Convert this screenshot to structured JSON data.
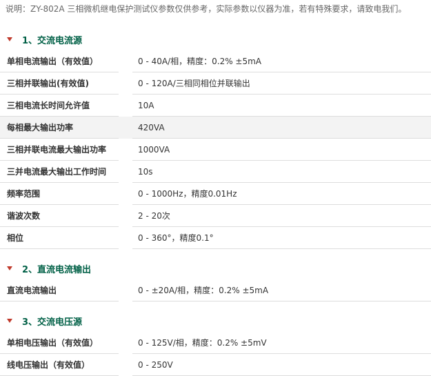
{
  "note": "说明：ZY-802A 三相微机继电保护测试仪参数仅供参考，实际参数以仪器为准，若有特殊要求，请致电我们。",
  "colors": {
    "section_title": "#006046",
    "caret": "#c0392b",
    "row_shade": "#f3f3f3",
    "divider": "#dddddd"
  },
  "sections": [
    {
      "title": "1、交流电流源",
      "rows": [
        {
          "label": "单相电流输出（有效值）",
          "value": "0 - 40A/相，精度：0.2%  ±5mA"
        },
        {
          "label": "三相并联输出(有效值)",
          "value": "0 - 120A/三相同相位并联输出"
        },
        {
          "label": "三相电流长时间允许值",
          "value": "10A"
        },
        {
          "label": "每相最大输出功率",
          "value": "420VA"
        },
        {
          "label": "三相并联电流最大输出功率",
          "value": "1000VA"
        },
        {
          "label": "三并电流最大输出工作时间",
          "value": "10s"
        },
        {
          "label": "频率范围",
          "value": "0 - 1000Hz，精度0.01Hz"
        },
        {
          "label": "谐波次数",
          "value": "2 - 20次"
        },
        {
          "label": "相位",
          "value": "0 - 360°，精度0.1°"
        }
      ]
    },
    {
      "title": "2、直流电流输出",
      "rows": [
        {
          "label": "直流电流输出",
          "value": "0 - ±20A/相，精度：0.2%  ±5mA"
        }
      ]
    },
    {
      "title": "3、交流电压源",
      "rows": [
        {
          "label": "单相电压输出（有效值）",
          "value": "0 - 125V/相，精度：0.2%  ±5mV"
        },
        {
          "label": "线电压输出（有效值）",
          "value": "0 - 250V"
        }
      ]
    }
  ]
}
